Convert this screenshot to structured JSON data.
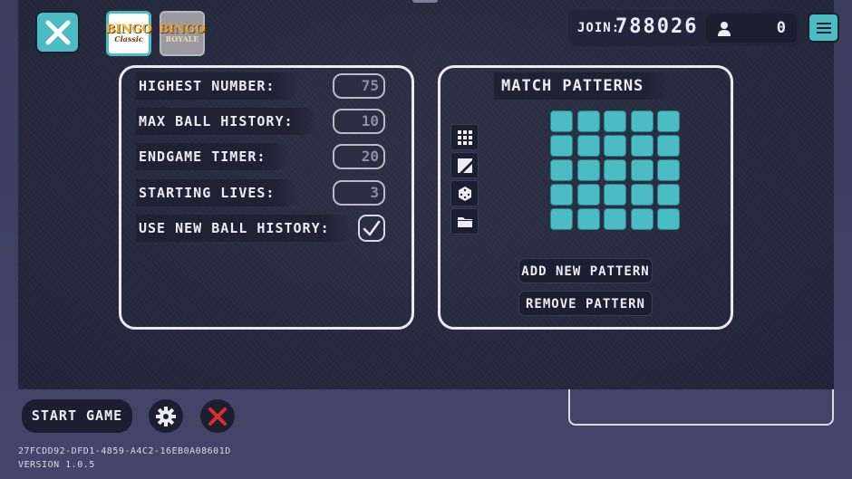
{
  "header": {
    "modes": [
      {
        "line1": "BINGO",
        "line2": "Classic"
      },
      {
        "line1": "BINGO",
        "line2": "ROYALE"
      }
    ],
    "join_label": "JOIN:",
    "join_code": "788026",
    "player_count": "0"
  },
  "settings": {
    "rows": [
      {
        "label": "HIGHEST NUMBER:",
        "value": "75"
      },
      {
        "label": "MAX BALL HISTORY:",
        "value": "10"
      },
      {
        "label": "ENDGAME TIMER:",
        "value": "20"
      },
      {
        "label": "STARTING LIVES:",
        "value": "3"
      }
    ],
    "toggle": {
      "label": "USE NEW BALL HISTORY:",
      "checked": true
    }
  },
  "patterns": {
    "title": "MATCH PATTERNS",
    "tools": [
      "grid-icon",
      "diagonal-icon",
      "dice-icon",
      "folder-icon"
    ],
    "grid_filled": [
      [
        1,
        1,
        1,
        1,
        1
      ],
      [
        1,
        1,
        1,
        1,
        1
      ],
      [
        1,
        1,
        1,
        1,
        1
      ],
      [
        1,
        1,
        1,
        1,
        1
      ],
      [
        1,
        1,
        1,
        1,
        1
      ]
    ],
    "add_label": "ADD NEW PATTERN",
    "remove_label": "REMOVE PATTERN"
  },
  "footer": {
    "start_label": "START GAME",
    "session_id": "27FCDD92-DFD1-4859-A4C2-16EB0A08601D",
    "version": "VERSION 1.0.5"
  },
  "colors": {
    "accent": "#4bbcc4",
    "danger": "#e02a2a"
  }
}
